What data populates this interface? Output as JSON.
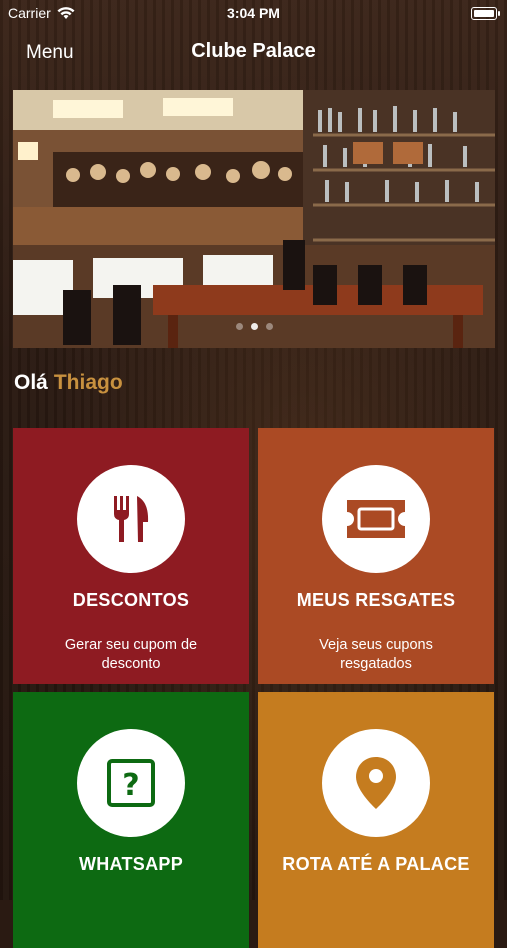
{
  "status_bar": {
    "carrier": "Carrier",
    "time": "3:04 PM"
  },
  "nav": {
    "menu_label": "Menu",
    "title": "Clube Palace"
  },
  "hero": {
    "slide_count": 3,
    "active_slide": 1
  },
  "greeting": {
    "hello": "Olá",
    "name": "Thiago"
  },
  "tiles": [
    {
      "title": "DESCONTOS",
      "subtitle": "Gerar seu cupom de desconto",
      "icon": "fork-knife-icon",
      "color": "#8e1b22"
    },
    {
      "title": "MEUS RESGATES",
      "subtitle": "Veja seus cupons resgatados",
      "icon": "ticket-icon",
      "color": "#ab4a24"
    },
    {
      "title": "WHATSAPP",
      "subtitle": "",
      "icon": "question-box-icon",
      "color": "#0d6a12"
    },
    {
      "title": "ROTA ATÉ A PALACE",
      "subtitle": "",
      "icon": "location-pin-icon",
      "color": "#c57c1f"
    }
  ],
  "colors": {
    "accent_name": "#c8913f"
  }
}
